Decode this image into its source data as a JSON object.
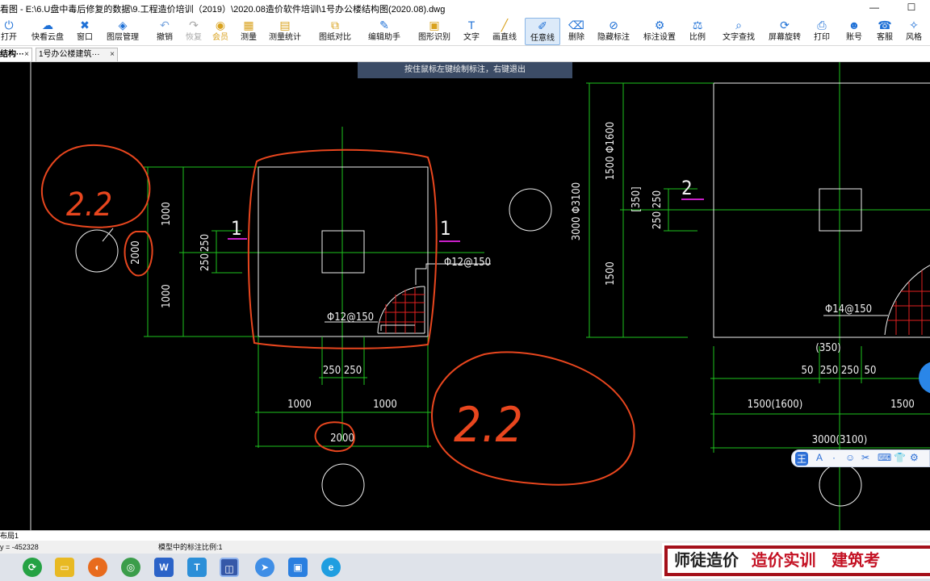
{
  "window": {
    "title": "看图 - E:\\6.U盘中毒后修复的数据\\9.工程造价培训（2019）\\2020.08造价软件培训\\1号办公楼结构图(2020.08).dwg",
    "min_label": "—",
    "max_label": "☐"
  },
  "toolbar": {
    "items": [
      {
        "label": "打开",
        "icon": "open-icon"
      },
      {
        "label": "快看云盘",
        "icon": "cloud-icon"
      },
      {
        "label": "窗口",
        "icon": "window-icon"
      },
      {
        "label": "图层管理",
        "icon": "layers-icon"
      },
      {
        "label": "撤销",
        "icon": "undo-icon"
      },
      {
        "label": "恢复",
        "icon": "redo-icon"
      },
      {
        "label": "会员",
        "icon": "vip-icon"
      },
      {
        "label": "测量",
        "icon": "measure-icon"
      },
      {
        "label": "测量统计",
        "icon": "measure-stats-icon"
      },
      {
        "label": "图纸对比",
        "icon": "compare-icon"
      },
      {
        "label": "编辑助手",
        "icon": "edit-assistant-icon"
      },
      {
        "label": "图形识别",
        "icon": "shape-recognize-icon"
      },
      {
        "label": "文字",
        "icon": "text-icon"
      },
      {
        "label": "画直线",
        "icon": "line-icon"
      },
      {
        "label": "任意线",
        "icon": "freehand-icon"
      },
      {
        "label": "删除",
        "icon": "eraser-icon"
      },
      {
        "label": "隐藏标注",
        "icon": "hide-annotation-icon"
      },
      {
        "label": "标注设置",
        "icon": "annotation-settings-icon"
      },
      {
        "label": "比例",
        "icon": "scale-icon"
      },
      {
        "label": "文字查找",
        "icon": "text-search-icon"
      },
      {
        "label": "屏幕旋转",
        "icon": "rotate-screen-icon"
      },
      {
        "label": "打印",
        "icon": "print-icon"
      },
      {
        "label": "账号",
        "icon": "account-icon"
      },
      {
        "label": "客服",
        "icon": "support-icon"
      },
      {
        "label": "风格",
        "icon": "style-icon"
      }
    ]
  },
  "tabs": [
    {
      "label": "结构···",
      "close": "×"
    },
    {
      "label": "1号办公楼建筑···",
      "close": "×"
    }
  ],
  "hint": "按住鼠标左键绘制标注，右键退出",
  "drawing": {
    "dims_left": [
      "1000",
      "1000",
      "250",
      "250",
      "2000"
    ],
    "section_1": "1",
    "rebar_1": "Φ12@150",
    "rebar_2": "Φ12@150",
    "dims_bottom_1": [
      "250",
      "250"
    ],
    "dims_bottom_2": [
      "1000",
      "1000"
    ],
    "dims_bottom_3": "2000",
    "dims_right_v": [
      "1500 Φ1600",
      "3000 Φ3100",
      "1500",
      "[350]",
      "250",
      "250"
    ],
    "section_2": "2",
    "rebar_3": "Φ14@150",
    "dims_right_b1": "(350)",
    "dims_right_b2": [
      "50",
      "250",
      "250",
      "50"
    ],
    "dims_right_b3": [
      "1500(1600)",
      "1500"
    ],
    "dims_right_b4": "3000(3100)",
    "handwriting": [
      "2.2",
      "2.2"
    ]
  },
  "layout_tab": "布局1",
  "status": {
    "coords": "y = -452328",
    "scale": "模型中的标注比例:1"
  },
  "promo": [
    "师徒造价",
    "造价实训",
    "建筑考"
  ],
  "ime": [
    "王",
    "A",
    "·",
    "☺",
    "✂",
    "⌨",
    "👕",
    "⚙"
  ],
  "colors": {
    "accent": "#1e70d6",
    "cad_green": "#1ec31e",
    "annotation": "#e8461e",
    "magenta": "#c81ec8"
  }
}
